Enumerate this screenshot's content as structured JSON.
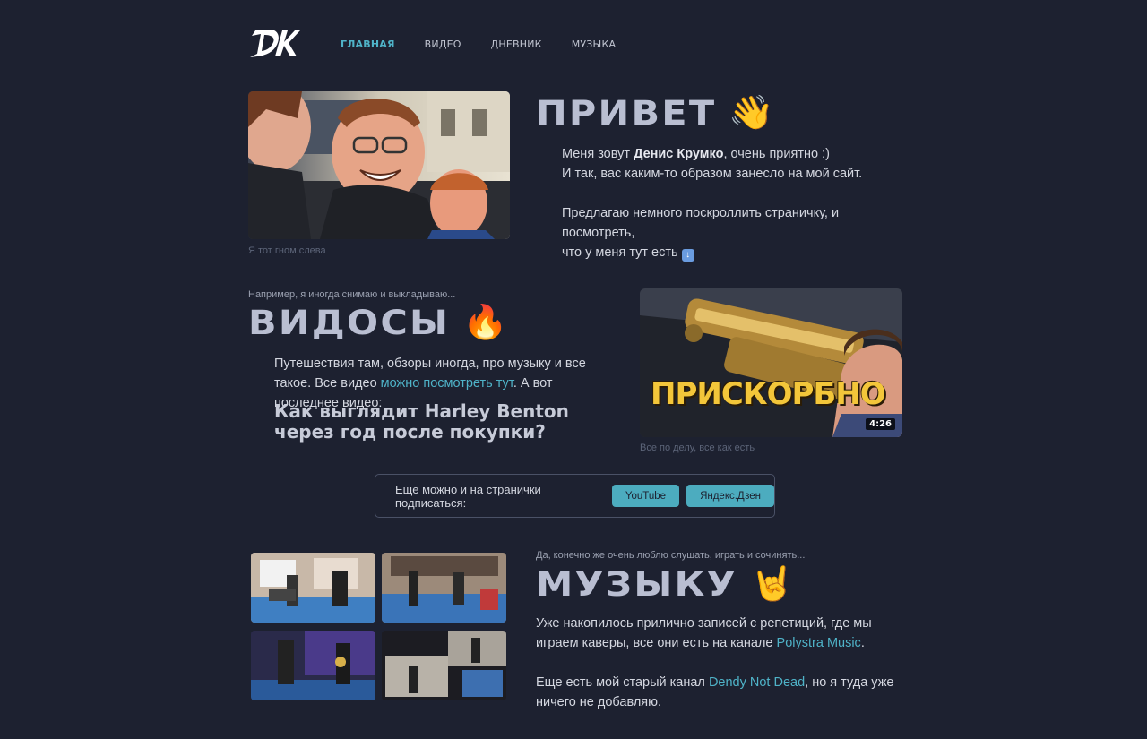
{
  "nav": {
    "logo_text": "DK",
    "links": [
      {
        "label": "ГЛАВНАЯ",
        "active": true
      },
      {
        "label": "ВИДЕО",
        "active": false
      },
      {
        "label": "ДНЕВНИК",
        "active": false
      },
      {
        "label": "МУЗЫКА",
        "active": false
      }
    ]
  },
  "hero": {
    "photo_caption": "Я тот гном слева",
    "title": "ПРИВЕТ",
    "title_emoji": "👋",
    "line1_prefix": "Меня зовут ",
    "line1_name": "Денис Крумко",
    "line1_suffix": ", очень приятно :)",
    "line2": "И так, вас каким-то образом занесло на мой сайт.",
    "line3": "Предлагаю немного поскроллить страничку, и посмотреть,",
    "line4": "что у меня тут есть",
    "down_icon": "arrow-down-icon"
  },
  "videos": {
    "kicker": "Например, я иногда снимаю и выкладываю...",
    "title": "ВИДОСЫ",
    "title_emoji": "🔥",
    "text_prefix": "Путешествия там, обзоры иногда, про музыку и все такое. Все видео ",
    "link_text": "можно посмотреть тут",
    "text_suffix": ". А вот последнее видео:",
    "latest_title": "Как выглядит Harley Benton через год после покупки?",
    "thumbnail_title": "ПРИСКОРБНО",
    "thumbnail_duration": "4:26",
    "thumbnail_caption": "Все по делу, все как есть"
  },
  "subscribe": {
    "label": "Еще можно и на странички подписаться:",
    "buttons": [
      "YouTube",
      "Яндекс.Дзен"
    ]
  },
  "music": {
    "kicker": "Да, конечно же очень люблю слушать, играть и сочинять...",
    "title": "МУЗЫКУ",
    "title_emoji": "🤘",
    "p1_prefix": "Уже накопилось прилично записей с репетиций, где мы играем каверы, все они есть на канале ",
    "p1_link": "Polystra Music",
    "p1_suffix": ".",
    "p2_prefix": "Еще есть мой старый канал ",
    "p2_link": "Dendy Not Dead",
    "p2_suffix": ", но я туда уже ничего не добавляю."
  },
  "colors": {
    "background": "#1d2130",
    "accent": "#4fb3c8",
    "title": "#b9bed1"
  }
}
